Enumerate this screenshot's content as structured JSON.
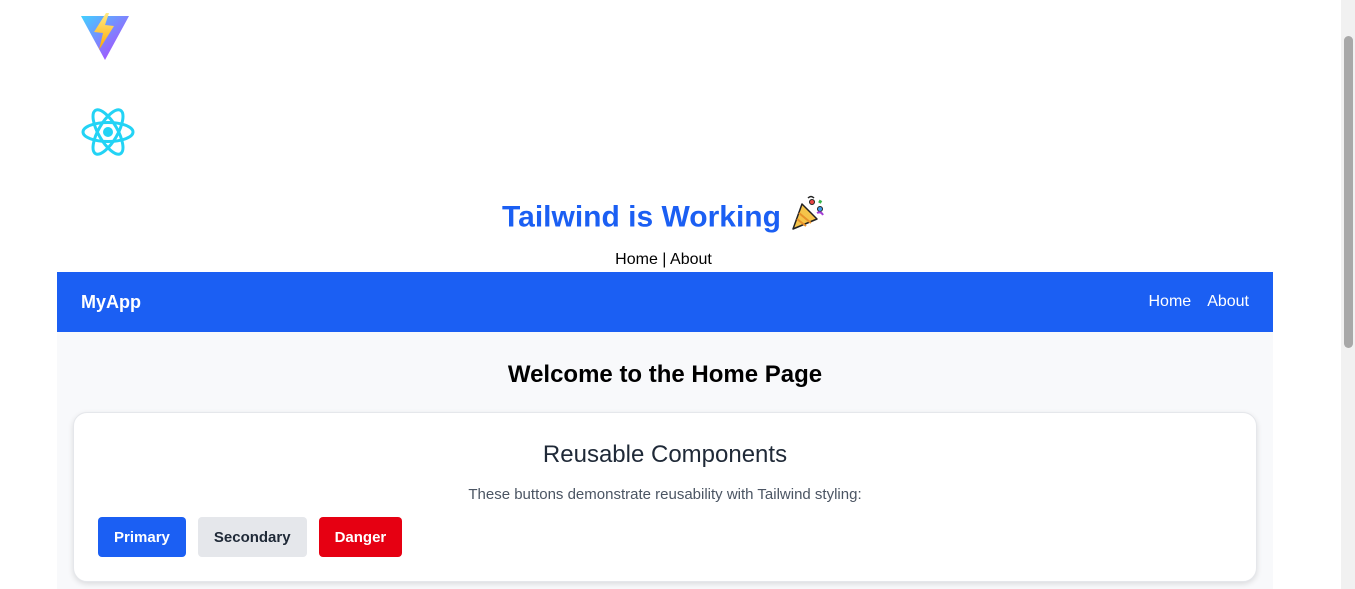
{
  "logos": {
    "vite": "vite-logo",
    "react": "react-logo"
  },
  "hero": {
    "title": "Tailwind is Working",
    "emoji_icon": "party-popper-icon"
  },
  "top_links": {
    "home": "Home",
    "separator": " | ",
    "about": "About"
  },
  "navbar": {
    "brand": "MyApp",
    "links": [
      "Home",
      "About"
    ],
    "color": "#1b5ff3"
  },
  "main": {
    "title": "Welcome to the Home Page",
    "card": {
      "title": "Reusable Components",
      "description": "These buttons demonstrate reusability with Tailwind styling:",
      "buttons": [
        {
          "label": "Primary",
          "color": "#1b5ff3"
        },
        {
          "label": "Secondary",
          "color": "#e5e7eb"
        },
        {
          "label": "Danger",
          "color": "#e60012"
        }
      ]
    }
  }
}
